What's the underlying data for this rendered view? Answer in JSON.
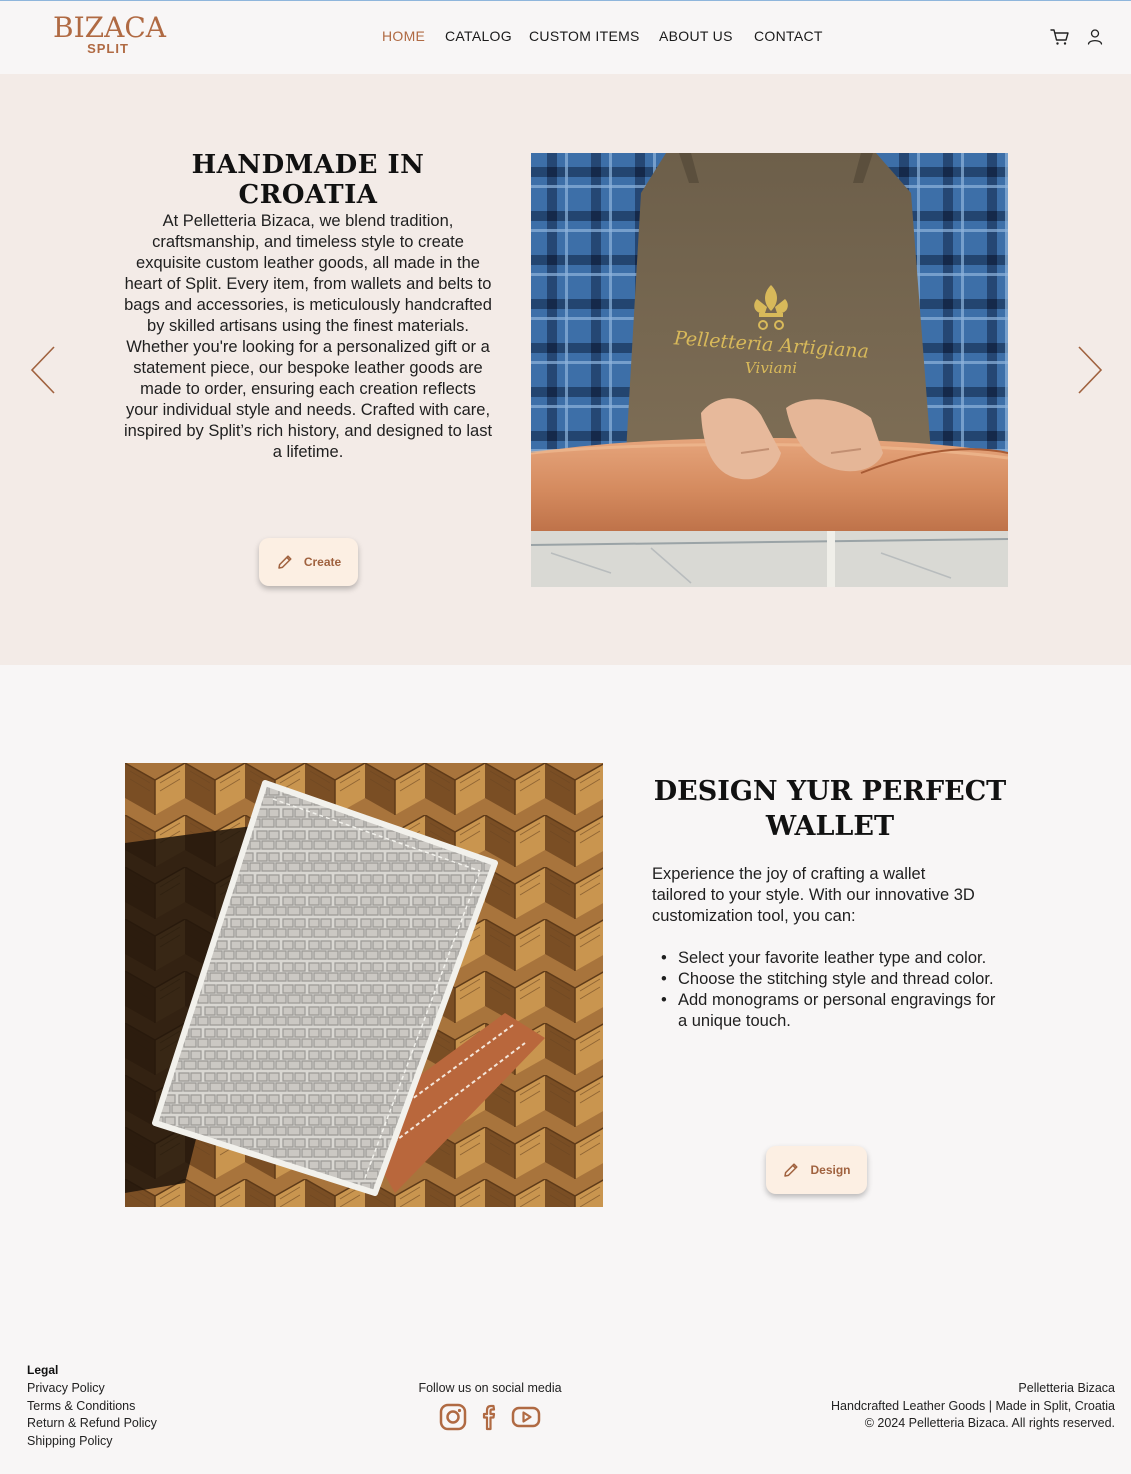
{
  "brand": {
    "name": "BIZACA",
    "sub": "SPLIT",
    "color": "#b06a43"
  },
  "nav": {
    "items": [
      {
        "label": "HOME",
        "active": true
      },
      {
        "label": "CATALOG",
        "active": false
      },
      {
        "label": "CUSTOM ITEMS",
        "active": false
      },
      {
        "label": "ABOUT US",
        "active": false
      },
      {
        "label": "CONTACT",
        "active": false
      }
    ],
    "icons": [
      "cart-icon",
      "user-icon"
    ]
  },
  "hero": {
    "title": "HANDMADE IN CROATIA",
    "text": "At Pelletteria Bizaca, we blend tradition, craftsmanship, and timeless style to create exquisite custom leather goods, all made in the heart of Split. Every item, from wallets and belts to bags and accessories, is meticulously handcrafted by skilled artisans using the finest materials.\nWhether you're looking for a personalized gift or a statement piece, our bespoke leather goods are made to order, ensuring each creation reflects your individual style and needs. Crafted with care, inspired by Split’s rich history, and designed to last a lifetime.",
    "button_label": "Create",
    "image_apron_text": "Pelletteria Artigiana",
    "image_apron_sub": "Viviani",
    "prev_icon": "chevron-left-icon",
    "next_icon": "chevron-right-icon"
  },
  "design": {
    "title": "DESIGN YUR PERFECT WALLET",
    "intro": "Experience the joy of crafting a wallet tailored to your style. With our innovative 3D customization tool, you can:",
    "bullets": [
      "Select your favorite leather type and color.",
      "Choose the stitching style and thread color.",
      "Add monograms or personal engravings for a unique touch."
    ],
    "button_label": "Design"
  },
  "footer": {
    "legal_title": "Legal",
    "legal_links": [
      "Privacy Policy",
      "Terms & Conditions",
      "Return & Refund Policy",
      "Shipping Policy"
    ],
    "follow": "Follow us on social media",
    "social_icons": [
      "instagram-icon",
      "facebook-icon",
      "youtube-icon"
    ],
    "company": "Pelletteria Bizaca",
    "tagline": "Handcrafted Leather Goods | Made in Split, Croatia",
    "copyright": "© 2024 Pelletteria Bizaca. All rights reserved."
  },
  "colors": {
    "accent": "#b06a43",
    "hero_bg": "#f3ebe7",
    "page_bg": "#f8f6f6",
    "button_bg": "#fcefe3"
  }
}
